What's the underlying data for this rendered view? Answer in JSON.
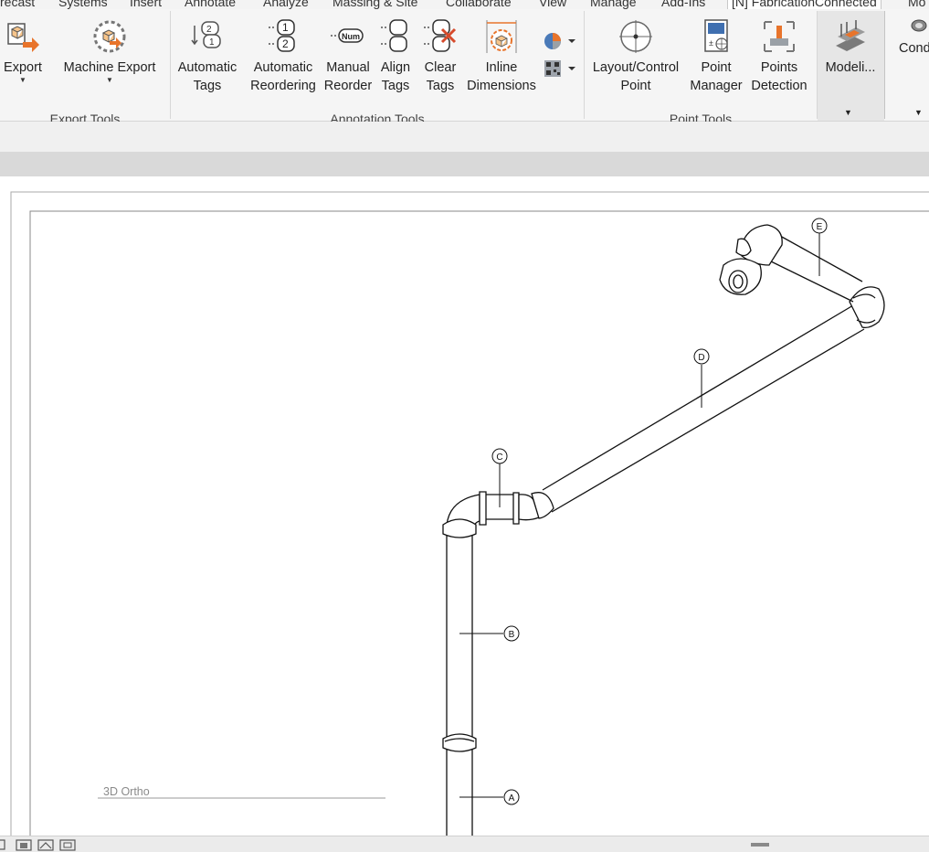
{
  "tabs": [
    "recast",
    "Systems",
    "Insert",
    "Annotate",
    "Analyze",
    "Massing & Site",
    "Collaborate",
    "View",
    "Manage",
    "Add-Ins",
    "[N] FabricationConnected",
    "Mo"
  ],
  "active_tab": "[N] FabricationConnected",
  "ribbon": {
    "export_tools": {
      "title": "Export Tools",
      "export": "Export",
      "machine_export": "Machine Export"
    },
    "annotation_tools": {
      "title": "Annotation Tools",
      "automatic_tags": [
        "Automatic",
        "Tags"
      ],
      "automatic_reordering": [
        "Automatic",
        "Reordering"
      ],
      "manual_reorder": [
        "Manual",
        "Reorder"
      ],
      "align_tags": [
        "Align",
        "Tags"
      ],
      "clear_tags": [
        "Clear",
        "Tags"
      ],
      "inline_dimensions": [
        "Inline",
        "Dimensions"
      ]
    },
    "point_tools": {
      "title": "Point Tools",
      "layout_control_point": [
        "Layout/Control",
        "Point"
      ],
      "point_manager": [
        "Point",
        "Manager"
      ],
      "points_detection": [
        "Points",
        "Detection"
      ]
    },
    "modeling": "Modeli...",
    "cond": "Cond",
    "manual_reorder_icon_text": "Num"
  },
  "viewport": {
    "view_name": "3D Ortho",
    "tags": [
      "A",
      "B",
      "C",
      "D",
      "E"
    ]
  },
  "colors": {
    "accent": "#e8742b",
    "ribbon_bg": "#f5f5f5",
    "band_gray": "#d9d9d9"
  }
}
